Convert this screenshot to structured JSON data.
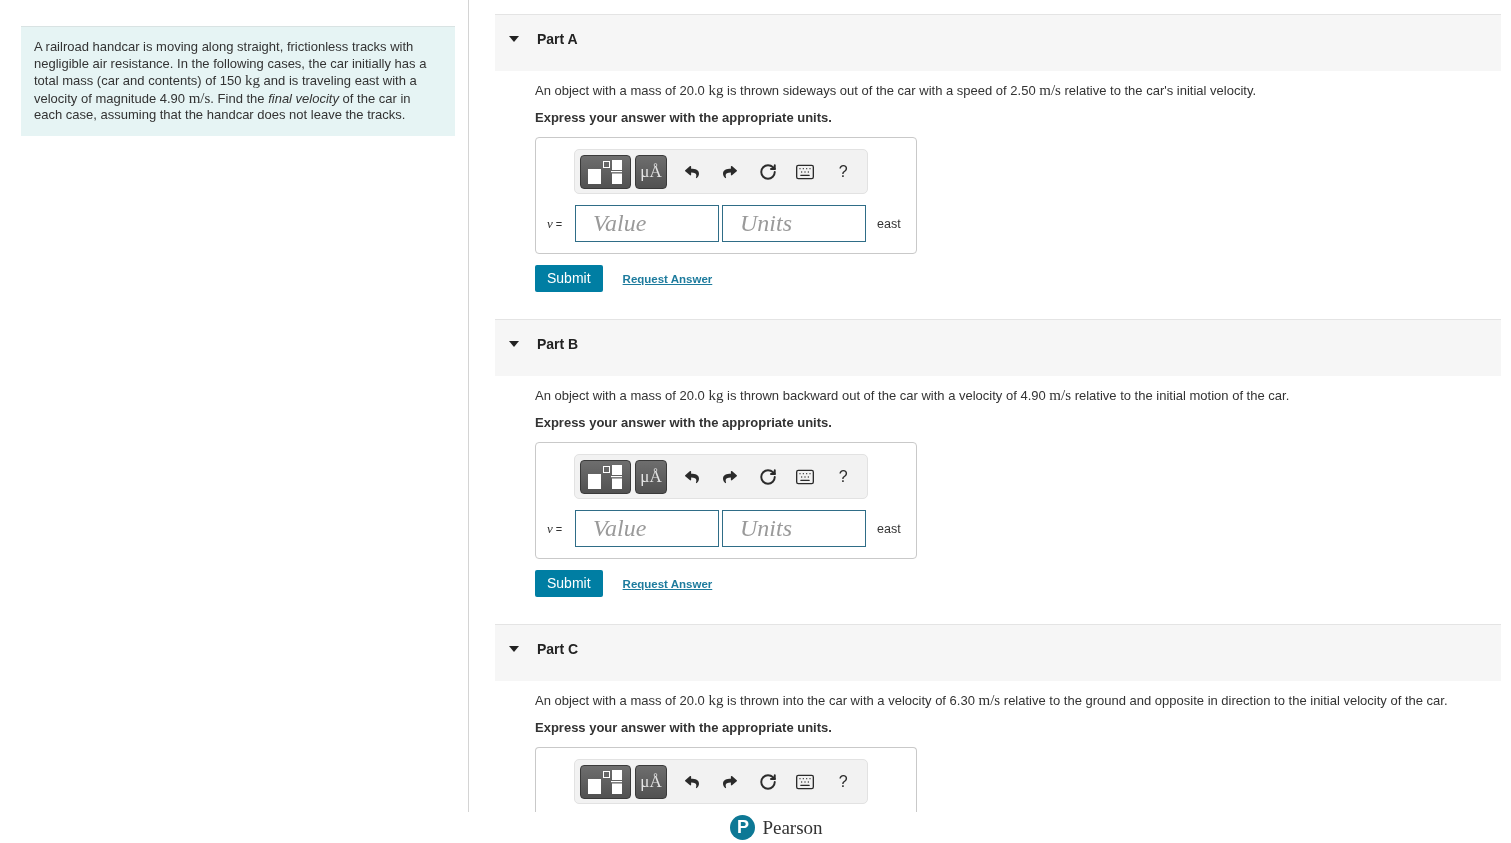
{
  "problem": [
    {
      "kind": "text",
      "text": "A railroad handcar is moving along straight, frictionless tracks with negligible air resistance. In the following cases, the car initially has a total mass (car and contents) of 150 "
    },
    {
      "kind": "math",
      "text": "kg"
    },
    {
      "kind": "text",
      "text": " and is traveling east with a velocity of magnitude 4.90 "
    },
    {
      "kind": "math",
      "text": "m/s"
    },
    {
      "kind": "text",
      "text": ". Find the *final velocity* of the car in each case, assuming that the handcar does not leave the tracks."
    }
  ],
  "parts": [
    {
      "title": "Part A",
      "expanded": true,
      "question": [
        {
          "kind": "text",
          "text": "An object with a mass of 20.0 "
        },
        {
          "kind": "math",
          "text": "kg"
        },
        {
          "kind": "text",
          "text": " is thrown sideways out of the car with a speed of 2.50 "
        },
        {
          "kind": "math",
          "text": "m/s"
        },
        {
          "kind": "text",
          "text": " relative to the car's initial velocity."
        }
      ],
      "instruction": "Express your answer with the appropriate units.",
      "answer": {
        "toolbar": [
          {
            "kind": "templates"
          },
          {
            "kind": "symbols",
            "label": "μÅ"
          },
          {
            "kind": "undo"
          },
          {
            "kind": "redo"
          },
          {
            "kind": "reset"
          },
          {
            "kind": "keyboard"
          },
          {
            "kind": "help",
            "label": "?"
          }
        ],
        "variable": "*v* =",
        "value_placeholder": "Value",
        "units_placeholder": "Units",
        "direction": "east"
      },
      "actions": {
        "submit": "Submit",
        "request": "Request Answer"
      }
    },
    {
      "title": "Part B",
      "expanded": true,
      "question": [
        {
          "kind": "text",
          "text": "An object with a mass of 20.0 "
        },
        {
          "kind": "math",
          "text": "kg"
        },
        {
          "kind": "text",
          "text": " is thrown backward out of the car with a velocity of 4.90 "
        },
        {
          "kind": "math",
          "text": "m/s"
        },
        {
          "kind": "text",
          "text": " relative to the initial motion of the car."
        }
      ],
      "instruction": "Express your answer with the appropriate units.",
      "answer": {
        "toolbar": [
          {
            "kind": "templates"
          },
          {
            "kind": "symbols",
            "label": "μÅ"
          },
          {
            "kind": "undo"
          },
          {
            "kind": "redo"
          },
          {
            "kind": "reset"
          },
          {
            "kind": "keyboard"
          },
          {
            "kind": "help",
            "label": "?"
          }
        ],
        "variable": "*v* =",
        "value_placeholder": "Value",
        "units_placeholder": "Units",
        "direction": "east"
      },
      "actions": {
        "submit": "Submit",
        "request": "Request Answer"
      }
    },
    {
      "title": "Part C",
      "expanded": true,
      "question": [
        {
          "kind": "text",
          "text": "An object with a mass of 20.0 "
        },
        {
          "kind": "math",
          "text": "kg"
        },
        {
          "kind": "text",
          "text": " is thrown into the car with a velocity of 6.30 "
        },
        {
          "kind": "math",
          "text": "m/s"
        },
        {
          "kind": "text",
          "text": " relative to the ground and opposite in direction to the initial velocity of the car."
        }
      ],
      "instruction": "Express your answer with the appropriate units.",
      "answer": {
        "toolbar": [
          {
            "kind": "templates"
          },
          {
            "kind": "symbols",
            "label": "μÅ"
          },
          {
            "kind": "undo"
          },
          {
            "kind": "redo"
          },
          {
            "kind": "reset"
          },
          {
            "kind": "keyboard"
          },
          {
            "kind": "help",
            "label": "?"
          }
        ]
      }
    }
  ],
  "footer": {
    "logo_mark": "P",
    "brand": "Pearson"
  }
}
